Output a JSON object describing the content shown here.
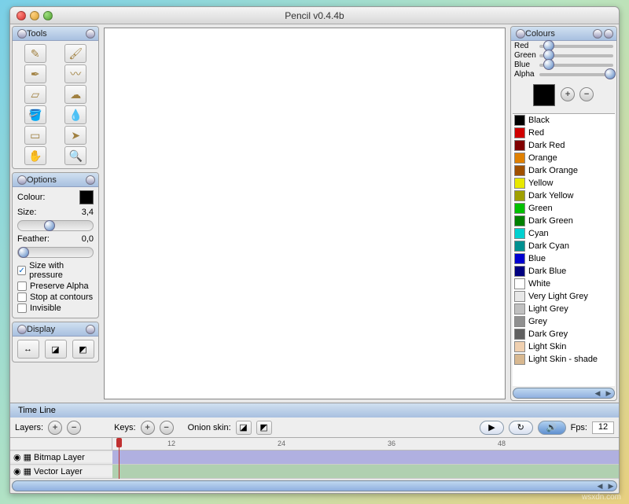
{
  "window": {
    "title": "Pencil v0.4.4b"
  },
  "panels": {
    "tools": {
      "title": "Tools"
    },
    "options": {
      "title": "Options",
      "colour_label": "Colour:",
      "size_label": "Size:",
      "size_value": "3,4",
      "feather_label": "Feather:",
      "feather_value": "0,0",
      "checks": [
        {
          "label": "Size with pressure",
          "checked": true
        },
        {
          "label": "Preserve Alpha",
          "checked": false
        },
        {
          "label": "Stop at contours",
          "checked": false
        },
        {
          "label": "Invisible",
          "checked": false
        }
      ]
    },
    "display": {
      "title": "Display"
    },
    "colours": {
      "title": "Colours",
      "channels": [
        "Red",
        "Green",
        "Blue",
        "Alpha"
      ],
      "list": [
        {
          "name": "Black",
          "hex": "#000000"
        },
        {
          "name": "Red",
          "hex": "#d00000"
        },
        {
          "name": "Dark Red",
          "hex": "#800000"
        },
        {
          "name": "Orange",
          "hex": "#e08000"
        },
        {
          "name": "Dark Orange",
          "hex": "#a05000"
        },
        {
          "name": "Yellow",
          "hex": "#e8e800"
        },
        {
          "name": "Dark Yellow",
          "hex": "#a0a000"
        },
        {
          "name": "Green",
          "hex": "#00c000"
        },
        {
          "name": "Dark Green",
          "hex": "#008000"
        },
        {
          "name": "Cyan",
          "hex": "#00d0d0"
        },
        {
          "name": "Dark Cyan",
          "hex": "#009090"
        },
        {
          "name": "Blue",
          "hex": "#0000d0"
        },
        {
          "name": "Dark Blue",
          "hex": "#000080"
        },
        {
          "name": "White",
          "hex": "#ffffff"
        },
        {
          "name": "Very Light Grey",
          "hex": "#e8e8e8"
        },
        {
          "name": "Light Grey",
          "hex": "#c0c0c0"
        },
        {
          "name": "Grey",
          "hex": "#909090"
        },
        {
          "name": "Dark Grey",
          "hex": "#606060"
        },
        {
          "name": "Light Skin",
          "hex": "#f0d0b0"
        },
        {
          "name": "Light Skin - shade",
          "hex": "#d8b890"
        }
      ]
    }
  },
  "timeline": {
    "title": "Time Line",
    "layers_label": "Layers:",
    "keys_label": "Keys:",
    "onion_label": "Onion skin:",
    "fps_label": "Fps:",
    "fps_value": "12",
    "ticks": [
      "12",
      "24",
      "36",
      "48"
    ],
    "layers": [
      {
        "name": "Bitmap Layer",
        "color": "#b0b0e0"
      },
      {
        "name": "Vector Layer",
        "color": "#b0d0b0"
      }
    ]
  },
  "watermark": "wsxdn.com"
}
